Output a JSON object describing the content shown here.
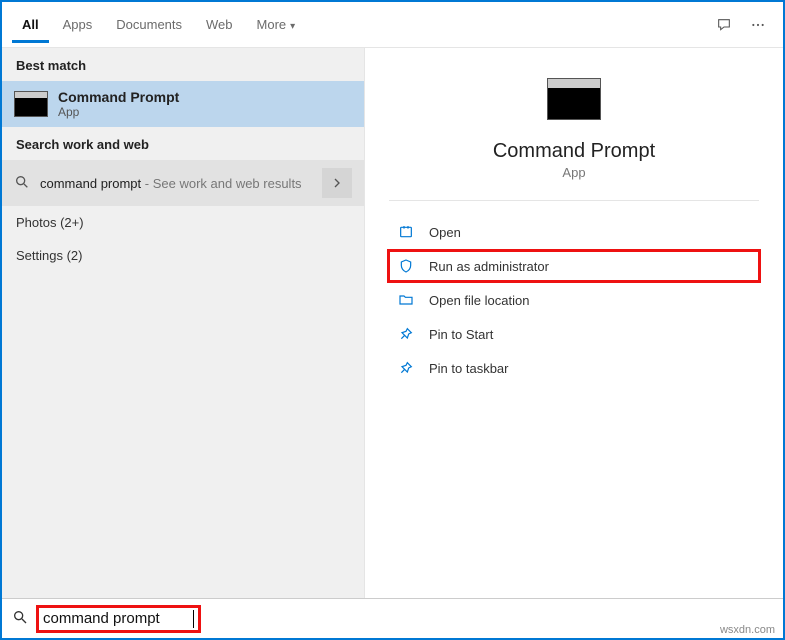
{
  "tabs": {
    "all": "All",
    "apps": "Apps",
    "documents": "Documents",
    "web": "Web",
    "more": "More"
  },
  "sections": {
    "best_match": "Best match",
    "search_web": "Search work and web"
  },
  "best_match": {
    "title": "Command Prompt",
    "subtitle": "App"
  },
  "web_item": {
    "query": "command prompt",
    "hint": " - See work and web results"
  },
  "categories": {
    "photos": "Photos (2+)",
    "settings": "Settings (2)"
  },
  "preview": {
    "title": "Command Prompt",
    "subtitle": "App"
  },
  "actions": {
    "open": "Open",
    "run_admin": "Run as administrator",
    "open_loc": "Open file location",
    "pin_start": "Pin to Start",
    "pin_taskbar": "Pin to taskbar"
  },
  "search": {
    "value": "command prompt"
  },
  "watermark": "wsxdn.com"
}
